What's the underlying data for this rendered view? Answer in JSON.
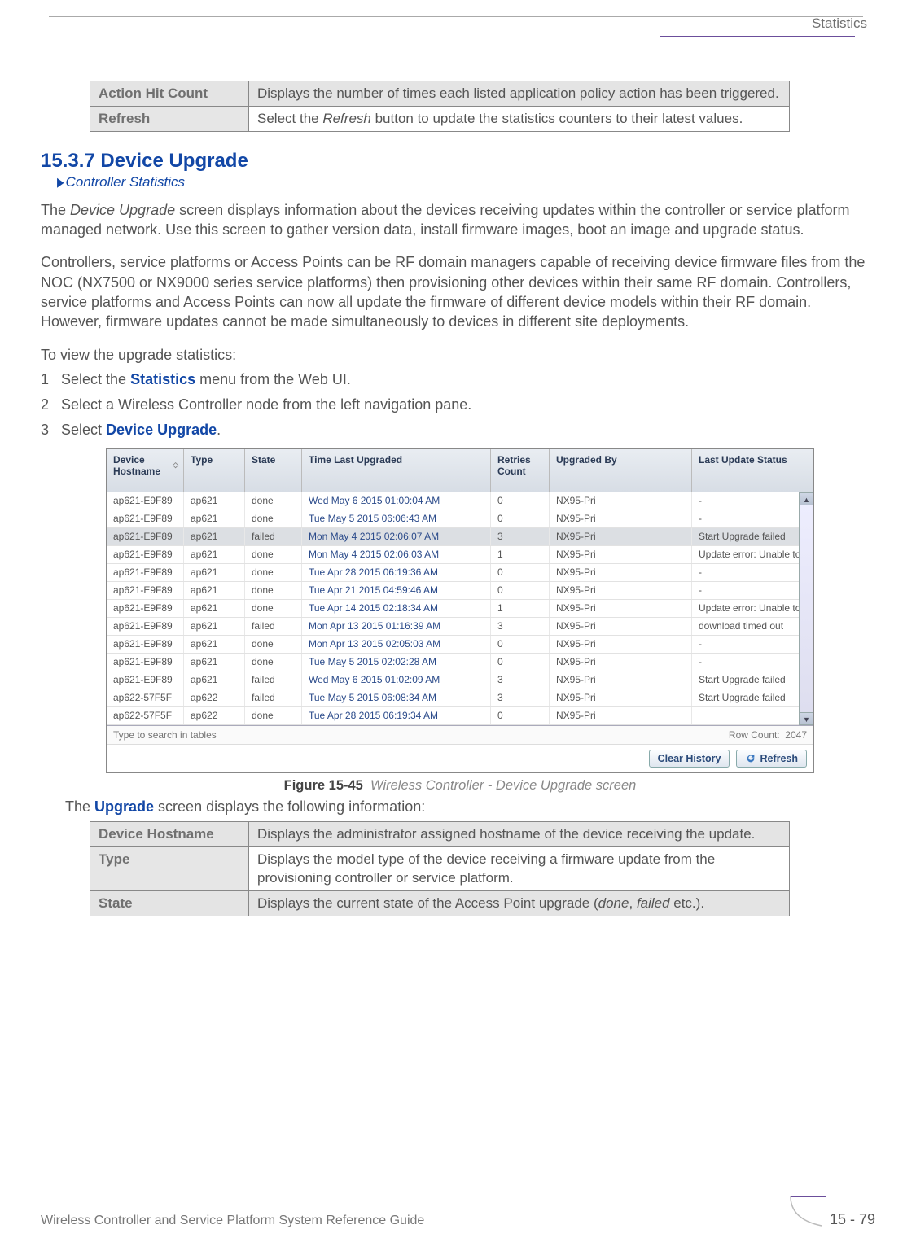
{
  "header": {
    "section_label": "Statistics"
  },
  "top_table": {
    "rows": [
      {
        "term": "Action Hit Count",
        "desc": "Displays the number of times each listed application policy action has been triggered."
      },
      {
        "term": "Refresh",
        "desc_pre": "Select the ",
        "desc_em": "Refresh",
        "desc_post": " button to update the statistics counters to their latest values."
      }
    ]
  },
  "section": {
    "number_title": "15.3.7 Device Upgrade",
    "breadcrumb": "Controller Statistics"
  },
  "paragraphs": {
    "p1_pre": "The ",
    "p1_em": "Device Upgrade",
    "p1_post": " screen displays information about the devices receiving updates within the controller or service platform managed network. Use this screen to gather version data, install firmware images, boot an image and upgrade status.",
    "p2": "Controllers, service platforms or Access Points can be RF domain managers capable of receiving device firmware files from the NOC (NX7500 or NX9000 series service platforms) then provisioning other devices within their same RF domain. Controllers, service platforms and Access Points can now all update the firmware of different device models within their RF domain. However, firmware updates cannot be made simultaneously to devices in different site deployments.",
    "p3": "To view the upgrade statistics:"
  },
  "steps": {
    "s1_pre": "Select the ",
    "s1_bold": "Statistics",
    "s1_post": " menu from the Web UI.",
    "s2": "Select a Wireless Controller node from the left navigation pane.",
    "s3_pre": "Select ",
    "s3_bold": "Device Upgrade",
    "s3_post": "."
  },
  "screenshot": {
    "headers": {
      "hostname": "Device Hostname",
      "type": "Type",
      "state": "State",
      "time": "Time Last Upgraded",
      "retries": "Retries Count",
      "upgraded_by": "Upgraded By",
      "last_status": "Last Update Status"
    },
    "rows": [
      {
        "host": "ap621-E9F89",
        "type": "ap621",
        "state": "done",
        "time": "Wed May 6 2015 01:00:04 AM",
        "ret": "0",
        "by": "NX95-Pri",
        "stat": "-"
      },
      {
        "host": "ap621-E9F89",
        "type": "ap621",
        "state": "done",
        "time": "Tue May 5 2015 06:06:43 AM",
        "ret": "0",
        "by": "NX95-Pri",
        "stat": "-"
      },
      {
        "host": "ap621-E9F89",
        "type": "ap621",
        "state": "failed",
        "time": "Mon May 4 2015 02:06:07 AM",
        "ret": "3",
        "by": "NX95-Pri",
        "stat": "Start Upgrade failed",
        "sel": true
      },
      {
        "host": "ap621-E9F89",
        "type": "ap621",
        "state": "done",
        "time": "Mon May 4 2015 02:06:03 AM",
        "ret": "1",
        "by": "NX95-Pri",
        "stat": "Update error:  Unable to get up"
      },
      {
        "host": "ap621-E9F89",
        "type": "ap621",
        "state": "done",
        "time": "Tue Apr 28 2015 06:19:36 AM",
        "ret": "0",
        "by": "NX95-Pri",
        "stat": "-"
      },
      {
        "host": "ap621-E9F89",
        "type": "ap621",
        "state": "done",
        "time": "Tue Apr 21 2015 04:59:46 AM",
        "ret": "0",
        "by": "NX95-Pri",
        "stat": "-"
      },
      {
        "host": "ap621-E9F89",
        "type": "ap621",
        "state": "done",
        "time": "Tue Apr 14 2015 02:18:34 AM",
        "ret": "1",
        "by": "NX95-Pri",
        "stat": "Update error:  Unable to get up"
      },
      {
        "host": "ap621-E9F89",
        "type": "ap621",
        "state": "failed",
        "time": "Mon Apr 13 2015 01:16:39 AM",
        "ret": "3",
        "by": "NX95-Pri",
        "stat": "download timed out"
      },
      {
        "host": "ap621-E9F89",
        "type": "ap621",
        "state": "done",
        "time": "Mon Apr 13 2015 02:05:03 AM",
        "ret": "0",
        "by": "NX95-Pri",
        "stat": "-"
      },
      {
        "host": "ap621-E9F89",
        "type": "ap621",
        "state": "done",
        "time": "Tue May 5 2015 02:02:28 AM",
        "ret": "0",
        "by": "NX95-Pri",
        "stat": "-"
      },
      {
        "host": "ap621-E9F89",
        "type": "ap621",
        "state": "failed",
        "time": "Wed May 6 2015 01:02:09 AM",
        "ret": "3",
        "by": "NX95-Pri",
        "stat": "Start Upgrade failed"
      },
      {
        "host": "ap622-57F5F",
        "type": "ap622",
        "state": "failed",
        "time": "Tue May 5 2015 06:08:34 AM",
        "ret": "3",
        "by": "NX95-Pri",
        "stat": "Start Upgrade failed"
      },
      {
        "host": "ap622-57F5F",
        "type": "ap622",
        "state": "done",
        "time": "Tue Apr 28 2015 06:19:34 AM",
        "ret": "0",
        "by": "NX95-Pri",
        "stat": ""
      }
    ],
    "search_placeholder": "Type to search in tables",
    "row_count_label": "Row Count:",
    "row_count_value": "2047",
    "btn_clear": "Clear History",
    "btn_refresh": "Refresh"
  },
  "figure": {
    "label": "Figure 15-45",
    "caption": "Wireless Controller - Device Upgrade screen"
  },
  "after_fig_pre": "The ",
  "after_fig_bold": "Upgrade",
  "after_fig_post": " screen displays the following information:",
  "bottom_table": {
    "rows": [
      {
        "term": "Device Hostname",
        "desc": "Displays the administrator assigned hostname of the device receiving the update."
      },
      {
        "term": "Type",
        "desc": "Displays the model type of the device receiving a firmware update from the provisioning controller or service platform."
      },
      {
        "term": "State",
        "desc_pre": "Displays the current state of the Access Point upgrade (",
        "desc_em1": "done",
        "desc_mid": ", ",
        "desc_em2": "failed",
        "desc_post": " etc.)."
      }
    ]
  },
  "footer": {
    "guide": "Wireless Controller and Service Platform System Reference Guide",
    "page": "15 - 79"
  }
}
